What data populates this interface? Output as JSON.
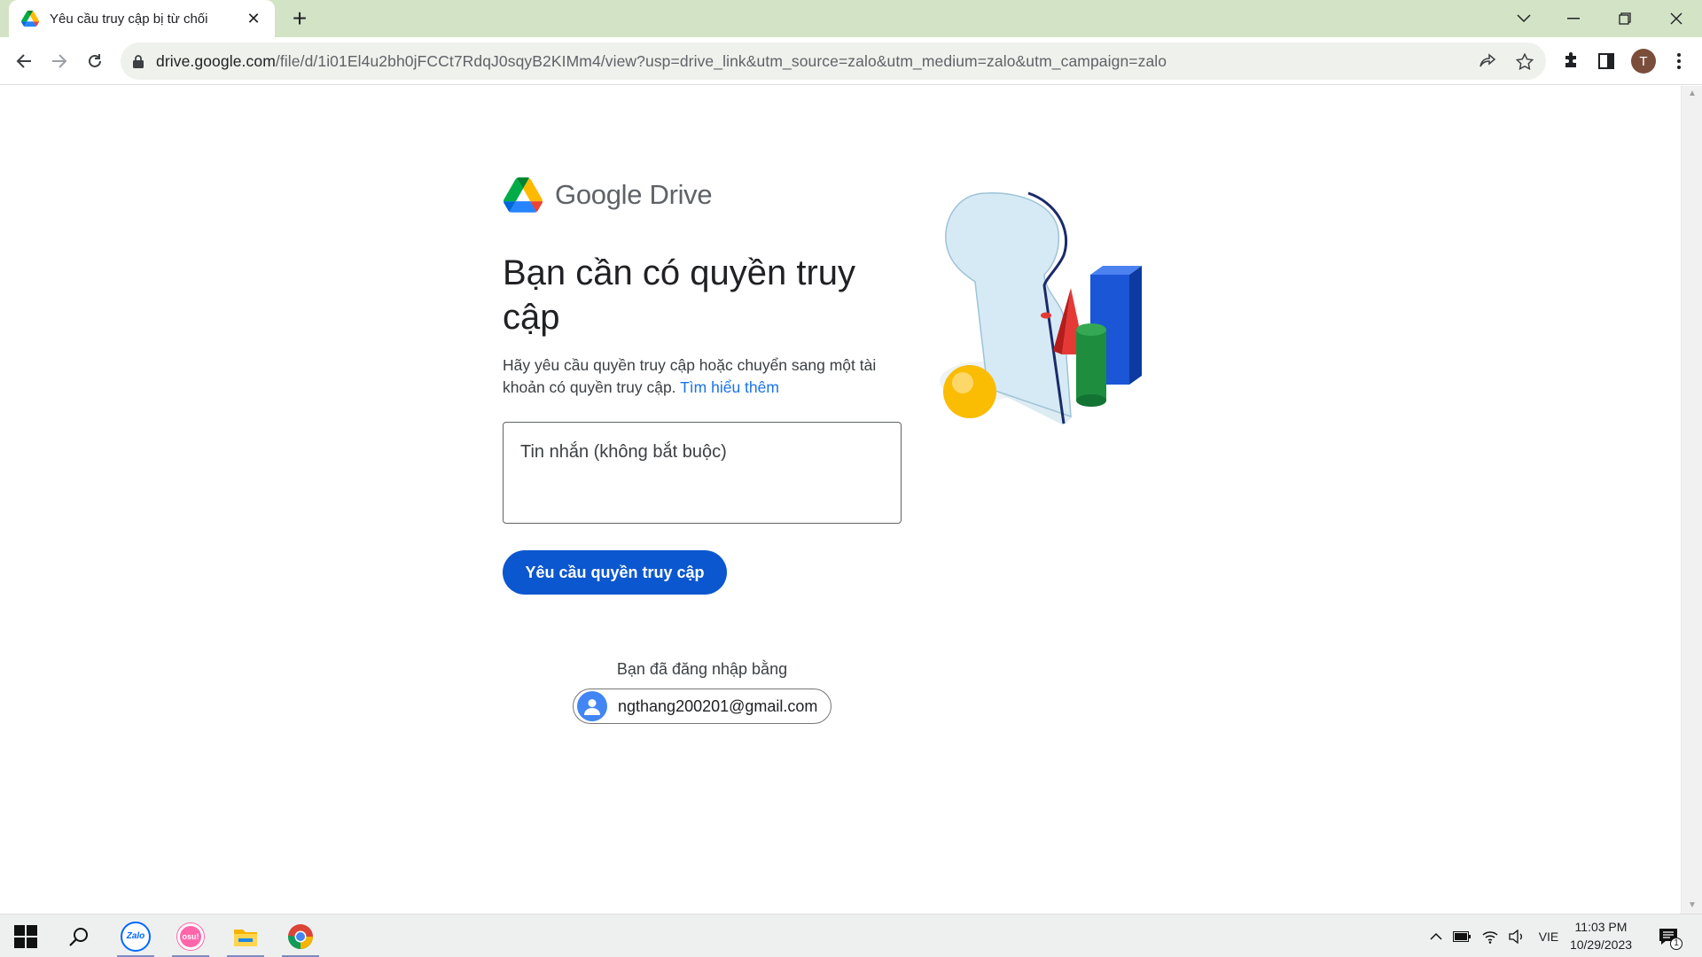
{
  "browser": {
    "tab_title": "Yêu cầu truy cập bị từ chối",
    "url_host": "drive.google.com",
    "url_path": "/file/d/1i01El4u2bh0jFCCt7RdqJ0sqyB2KIMm4/view?usp=drive_link&utm_source=zalo&utm_medium=zalo&utm_campaign=zalo",
    "profile_initial": "T"
  },
  "page": {
    "logo_text": "Google Drive",
    "heading": "Bạn cần có quyền truy cập",
    "description": "Hãy yêu cầu quyền truy cập hoặc chuyển sang một tài khoản có quyền truy cập.",
    "learn_more": "Tìm hiểu thêm",
    "message_placeholder": "Tin nhắn (không bắt buộc)",
    "request_button": "Yêu cầu quyền truy cập",
    "signed_in_label": "Bạn đã đăng nhập bằng",
    "account_email": "ngthang200201@gmail.com"
  },
  "taskbar": {
    "apps": [
      "start",
      "search",
      "zalo",
      "osu",
      "file-explorer",
      "chrome"
    ],
    "zalo_label": "Zalo",
    "osu_label": "osu!",
    "language": "VIE",
    "time": "11:03 PM",
    "date": "10/29/2023",
    "notification_count": "1"
  },
  "colors": {
    "tabstrip": "#d3e3c6",
    "primary_button": "#0b57d0",
    "link": "#1a73e8"
  }
}
